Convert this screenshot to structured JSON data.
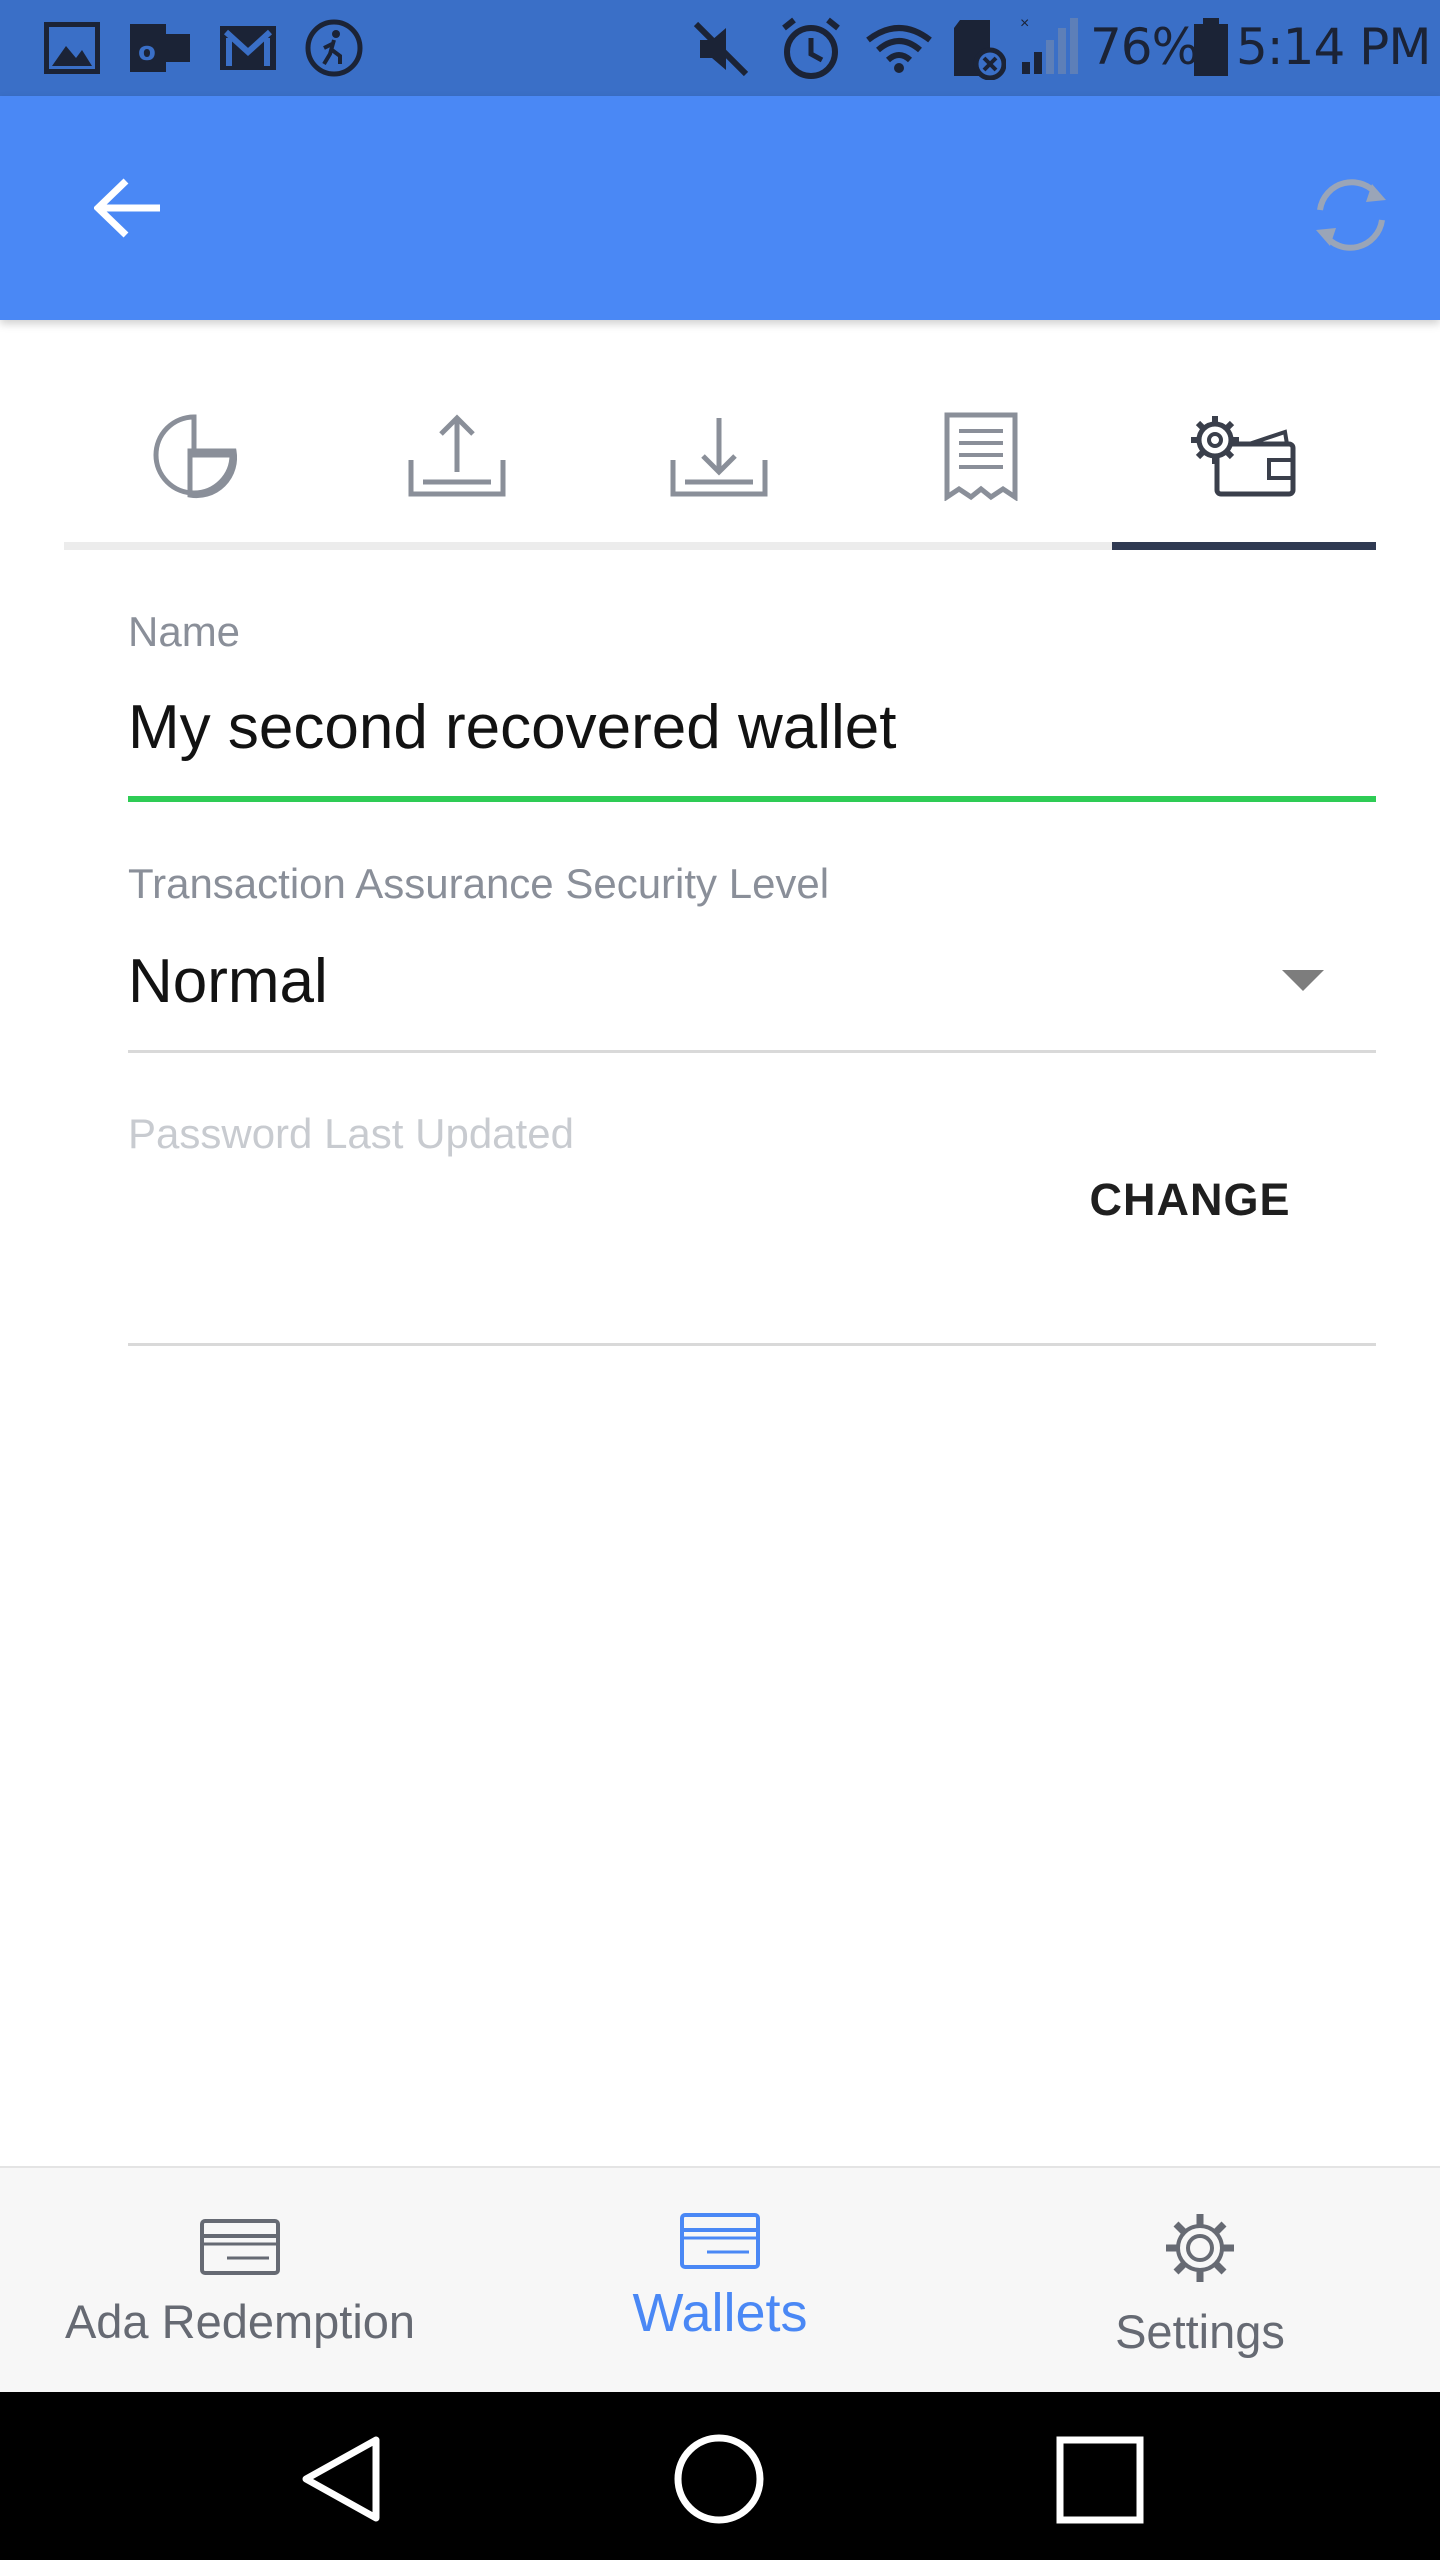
{
  "status_bar": {
    "battery": "76%",
    "time": "5:14 PM",
    "left_icons": [
      "gallery-icon",
      "outlook-icon",
      "gmail-icon",
      "fitness-icon"
    ],
    "right_icons": [
      "mute-icon",
      "alarm-icon",
      "wifi-icon",
      "sd-card-icon",
      "signal-icon",
      "battery-icon"
    ]
  },
  "app_bar": {
    "back_icon": "arrow-left-icon",
    "refresh_icon": "sync-icon",
    "background": "#4a88f5"
  },
  "tabs": [
    {
      "name": "summary",
      "icon": "pie-chart-icon",
      "active": false
    },
    {
      "name": "send",
      "icon": "upload-icon",
      "active": false
    },
    {
      "name": "receive",
      "icon": "download-icon",
      "active": false
    },
    {
      "name": "transactions",
      "icon": "receipt-icon",
      "active": false
    },
    {
      "name": "wallet-settings",
      "icon": "wallet-gear-icon",
      "active": true
    }
  ],
  "form": {
    "name_label": "Name",
    "name_value": "My second recovered wallet",
    "assurance_label": "Transaction Assurance Security Level",
    "assurance_value": "Normal",
    "password_label": "Password Last Updated",
    "change_button": "CHANGE"
  },
  "colors": {
    "accent": "#4a88f5",
    "valid_underline": "#2ecc55",
    "active_tab_indicator": "#2f3a52"
  },
  "bottom_nav": {
    "items": [
      {
        "label": "Ada Redemption",
        "icon": "card-icon",
        "active": false
      },
      {
        "label": "Wallets",
        "icon": "wallet-card-icon",
        "active": true
      },
      {
        "label": "Settings",
        "icon": "gear-icon",
        "active": false
      }
    ]
  },
  "system_nav": {
    "icons": [
      "back-triangle-icon",
      "home-circle-icon",
      "recents-square-icon"
    ]
  }
}
